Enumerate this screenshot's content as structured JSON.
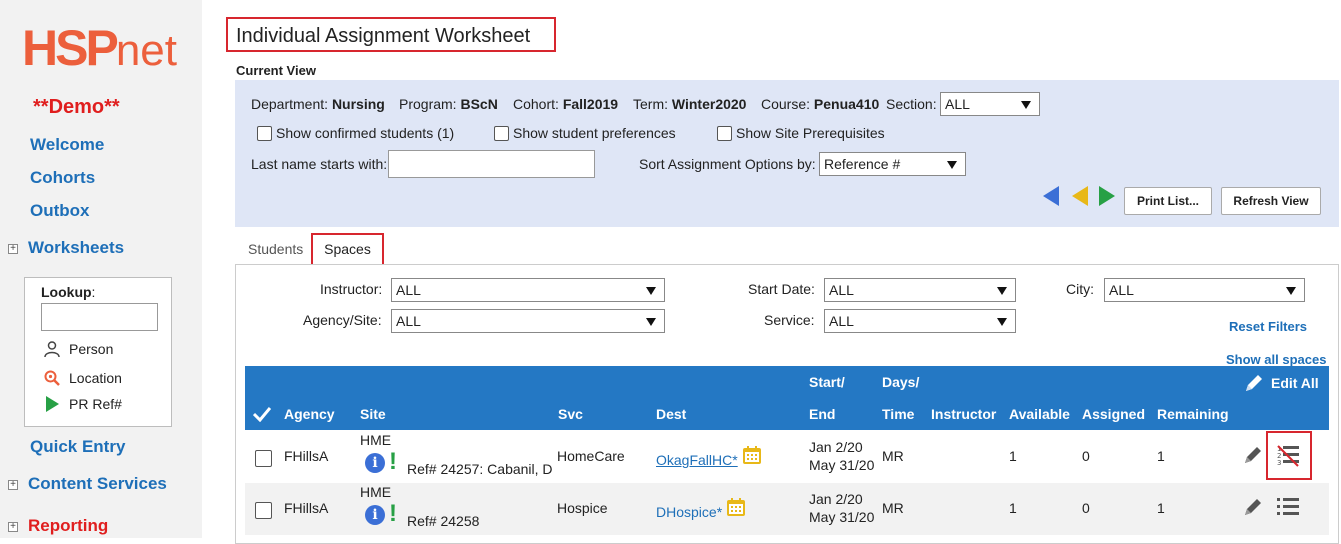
{
  "sidebar": {
    "logo_hsp": "HSP",
    "logo_net": "net",
    "demo_label": "**Demo**",
    "nav": {
      "welcome": "Welcome",
      "cohorts": "Cohorts",
      "outbox": "Outbox",
      "worksheets": "Worksheets",
      "quick_entry": "Quick Entry",
      "content_services": "Content Services",
      "reporting": "Reporting"
    },
    "lookup": {
      "title": "Lookup",
      "colon": ":",
      "items": [
        "Person",
        "Location",
        "PR Ref#"
      ]
    }
  },
  "page_title": "Individual Assignment Worksheet",
  "current_view": {
    "label": "Current View",
    "department_label": "Department:",
    "department": "Nursing",
    "program_label": "Program:",
    "program": "BScN",
    "cohort_label": "Cohort:",
    "cohort": "Fall2019",
    "term_label": "Term:",
    "term": "Winter2020",
    "course_label": "Course:",
    "course": "Penua410",
    "section_label": "Section:",
    "section_value": "ALL",
    "show_confirmed": "Show confirmed students (1)",
    "show_preferences": "Show student preferences",
    "show_prereq": "Show Site Prerequisites",
    "last_name_label": "Last name starts with:",
    "last_name_value": "",
    "sort_label": "Sort Assignment Options by:",
    "sort_value": "Reference #",
    "print_button": "Print List...",
    "refresh_button": "Refresh View"
  },
  "tabs": [
    "Students",
    "Spaces"
  ],
  "spaces_filters": {
    "instructor_label": "Instructor:",
    "instructor_value": "ALL",
    "agency_label": "Agency/Site:",
    "agency_value": "ALL",
    "start_date_label": "Start Date:",
    "start_date_value": "ALL",
    "service_label": "Service:",
    "service_value": "ALL",
    "city_label": "City:",
    "city_value": "ALL",
    "reset_filters": "Reset Filters",
    "show_all_spaces": "Show all spaces"
  },
  "table": {
    "edit_all": "Edit All",
    "headers": {
      "agency": "Agency",
      "site": "Site",
      "svc": "Svc",
      "dest": "Dest",
      "start_top": "Start/",
      "start_bottom": "End",
      "days_top": "Days/",
      "days_bottom": "Time",
      "instructor": "Instructor",
      "available": "Available",
      "assigned": "Assigned",
      "remaining": "Remaining"
    },
    "rows": [
      {
        "agency": "FHillsA",
        "site": "HME",
        "ref": "Ref# 24257: Cabanil, D",
        "svc": "HomeCare",
        "dest": "OkagFallHC*",
        "start": "Jan 2/20",
        "end": "May 31/20",
        "days": "MR",
        "available": "1",
        "assigned": "0",
        "remaining": "1"
      },
      {
        "agency": "FHillsA",
        "site": "HME",
        "ref": "Ref# 24258",
        "svc": "Hospice",
        "dest": "DHospice*",
        "start": "Jan 2/20",
        "end": "May 31/20",
        "days": "MR",
        "available": "1",
        "assigned": "0",
        "remaining": "1"
      }
    ]
  },
  "colors": {
    "brand": "#ec5f3c",
    "link": "#1e6fb8",
    "header_bg": "#2478c4",
    "highlight": "#d7262e",
    "panel_bg": "#dfe6f6"
  }
}
